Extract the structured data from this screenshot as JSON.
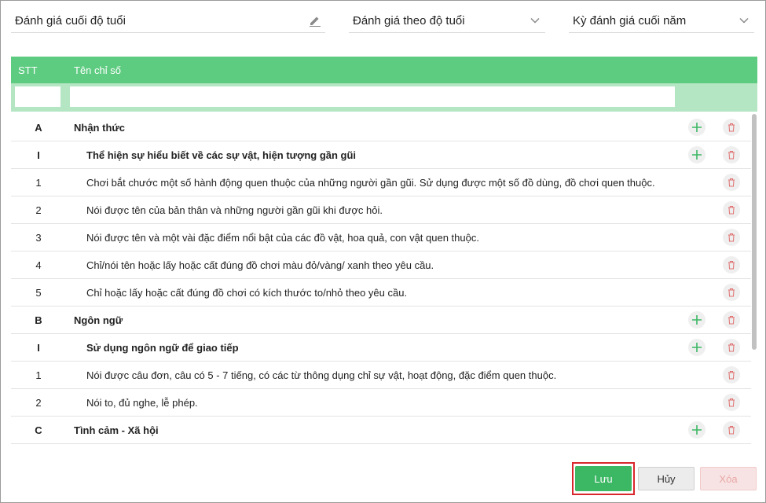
{
  "header": {
    "title_value": "Đánh giá cuối độ tuổi",
    "type_value": "Đánh giá theo độ tuổi",
    "period_value": "Kỳ đánh giá cuối năm"
  },
  "table": {
    "col_stt": "STT",
    "col_name": "Tên chỉ số",
    "rows": [
      {
        "stt": "A",
        "name": "Nhận thức"
      },
      {
        "stt": "I",
        "name": "Thể hiện sự hiểu biết về các sự vật, hiện tượng gần gũi"
      },
      {
        "stt": "1",
        "name": "Chơi bắt chước một số hành động quen thuộc của những người gần gũi. Sử dụng được một số đồ dùng, đồ chơi quen thuộc."
      },
      {
        "stt": "2",
        "name": "Nói được tên của bản thân và những người gần gũi khi được hỏi."
      },
      {
        "stt": "3",
        "name": "Nói được tên và một vài đặc điểm nổi bật của các đồ vật, hoa quả, con vật quen thuộc."
      },
      {
        "stt": "4",
        "name": "Chỉ/nói tên hoặc lấy hoặc cất đúng đồ chơi màu đỏ/vàng/ xanh theo yêu cầu."
      },
      {
        "stt": "5",
        "name": "Chỉ hoặc lấy hoặc cất đúng đồ chơi có kích thước to/nhỏ theo yêu cầu."
      },
      {
        "stt": "B",
        "name": "Ngôn ngữ"
      },
      {
        "stt": "I",
        "name": "Sử dụng ngôn ngữ để giao tiếp"
      },
      {
        "stt": "1",
        "name": "Nói được câu đơn, câu có 5 - 7 tiếng, có các từ thông dụng chỉ sự vật, hoạt động, đặc điểm quen thuộc."
      },
      {
        "stt": "2",
        "name": "Nói to, đủ nghe, lễ phép."
      },
      {
        "stt": "C",
        "name": "Tình cảm - Xã hội"
      }
    ]
  },
  "buttons": {
    "save": "Lưu",
    "cancel": "Hủy",
    "delete": "Xóa"
  },
  "colors": {
    "header_green": "#5dcb80",
    "filter_green": "#b5e6c4",
    "save_green": "#3cb764",
    "delete_red": "#e07070"
  },
  "icons": [
    "pencil-icon",
    "chevron-down-icon",
    "plus-icon",
    "trash-icon"
  ]
}
